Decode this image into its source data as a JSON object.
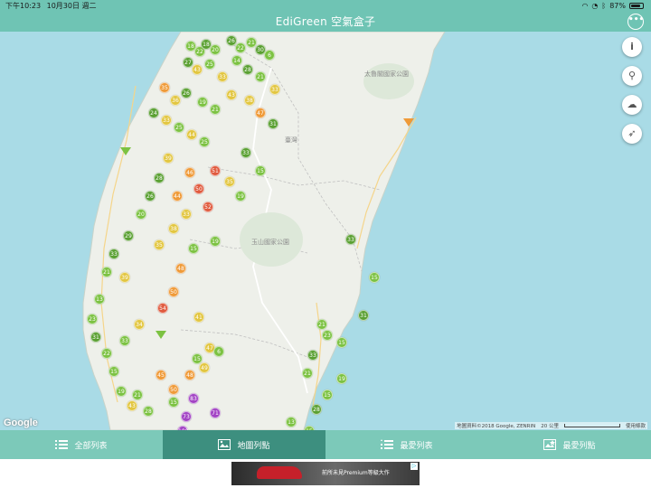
{
  "status_bar": {
    "time": "下午10:23",
    "date": "10月30日 週二",
    "battery": "87%",
    "battery_level": 0.87
  },
  "title_bar": {
    "title": "EdiGreen 空氣盒子",
    "more_icon": "ellipsis-icon"
  },
  "map": {
    "provider_logo": "Google",
    "attribution": "地圖資料©2018 Google, ZENRIN",
    "scale_label": "20 公里",
    "terms_label": "使用條款",
    "place_labels": [
      "太魯閣國家公園",
      "臺灣",
      "玉山國家公園"
    ],
    "controls": [
      {
        "name": "info-icon",
        "label": "i"
      },
      {
        "name": "location-pin-icon",
        "label": "⚲"
      },
      {
        "name": "cloud-icon",
        "label": "☁"
      },
      {
        "name": "navigate-icon",
        "label": "➶"
      }
    ],
    "markers": [
      {
        "v": "18",
        "c": "green"
      },
      {
        "v": "22",
        "c": "green"
      },
      {
        "v": "18",
        "c": "dgreen"
      },
      {
        "v": "20",
        "c": "green"
      },
      {
        "v": "26",
        "c": "dgreen"
      },
      {
        "v": "22",
        "c": "green"
      },
      {
        "v": "21",
        "c": "green"
      },
      {
        "v": "30",
        "c": "dgreen"
      },
      {
        "v": "6",
        "c": "green"
      },
      {
        "v": "27",
        "c": "dgreen"
      },
      {
        "v": "43",
        "c": "yellow"
      },
      {
        "v": "25",
        "c": "green"
      },
      {
        "v": "33",
        "c": "yellow"
      },
      {
        "v": "14",
        "c": "green"
      },
      {
        "v": "28",
        "c": "dgreen"
      },
      {
        "v": "21",
        "c": "green"
      },
      {
        "v": "33",
        "c": "yellow"
      },
      {
        "v": "35",
        "c": "orange"
      },
      {
        "v": "36",
        "c": "yellow"
      },
      {
        "v": "26",
        "c": "dgreen"
      },
      {
        "v": "19",
        "c": "green"
      },
      {
        "v": "21",
        "c": "green"
      },
      {
        "v": "43",
        "c": "yellow"
      },
      {
        "v": "38",
        "c": "yellow"
      },
      {
        "v": "47",
        "c": "orange"
      },
      {
        "v": "24",
        "c": "dgreen"
      },
      {
        "v": "33",
        "c": "yellow"
      },
      {
        "v": "25",
        "c": "green"
      },
      {
        "v": "44",
        "c": "yellow"
      },
      {
        "v": "25",
        "c": "green"
      },
      {
        "v": "39",
        "c": "yellow"
      },
      {
        "v": "28",
        "c": "dgreen"
      },
      {
        "v": "26",
        "c": "dgreen"
      },
      {
        "v": "20",
        "c": "green"
      },
      {
        "v": "29",
        "c": "dgreen"
      },
      {
        "v": "46",
        "c": "orange"
      },
      {
        "v": "51",
        "c": "red"
      },
      {
        "v": "35",
        "c": "yellow"
      },
      {
        "v": "19",
        "c": "green"
      },
      {
        "v": "44",
        "c": "orange"
      },
      {
        "v": "50",
        "c": "red"
      },
      {
        "v": "52",
        "c": "red"
      },
      {
        "v": "33",
        "c": "yellow"
      },
      {
        "v": "38",
        "c": "yellow"
      },
      {
        "v": "35",
        "c": "yellow"
      },
      {
        "v": "19",
        "c": "green"
      },
      {
        "v": "33",
        "c": "dgreen"
      },
      {
        "v": "15",
        "c": "green"
      },
      {
        "v": "31",
        "c": "dgreen"
      },
      {
        "v": "15",
        "c": "green"
      },
      {
        "v": "48",
        "c": "orange"
      },
      {
        "v": "50",
        "c": "orange"
      },
      {
        "v": "54",
        "c": "red"
      },
      {
        "v": "34",
        "c": "yellow"
      },
      {
        "v": "33",
        "c": "green"
      },
      {
        "v": "41",
        "c": "yellow"
      },
      {
        "v": "47",
        "c": "yellow"
      },
      {
        "v": "6",
        "c": "green"
      },
      {
        "v": "49",
        "c": "yellow"
      },
      {
        "v": "48",
        "c": "orange"
      },
      {
        "v": "50",
        "c": "orange"
      },
      {
        "v": "21",
        "c": "green"
      },
      {
        "v": "28",
        "c": "green"
      },
      {
        "v": "15",
        "c": "green"
      },
      {
        "v": "73",
        "c": "purple"
      },
      {
        "v": "83",
        "c": "purple"
      },
      {
        "v": "100",
        "c": "purple"
      },
      {
        "v": "71",
        "c": "purple"
      },
      {
        "v": "15",
        "c": "green"
      },
      {
        "v": "45",
        "c": "orange"
      },
      {
        "v": "39",
        "c": "yellow"
      },
      {
        "v": "33",
        "c": "dgreen"
      },
      {
        "v": "21",
        "c": "green"
      },
      {
        "v": "13",
        "c": "green"
      },
      {
        "v": "23",
        "c": "green"
      },
      {
        "v": "31",
        "c": "dgreen"
      },
      {
        "v": "22",
        "c": "green"
      },
      {
        "v": "15",
        "c": "green"
      },
      {
        "v": "19",
        "c": "green"
      },
      {
        "v": "43",
        "c": "yellow"
      }
    ]
  },
  "bottom_nav": {
    "tabs": [
      {
        "label": "全部列表",
        "icon": "list-icon"
      },
      {
        "label": "地圖列點",
        "icon": "map-icon",
        "active": true
      },
      {
        "label": "最愛列表",
        "icon": "favorites-list-icon"
      },
      {
        "label": "最愛列點",
        "icon": "favorites-map-icon"
      }
    ]
  },
  "ad": {
    "text": "前所未見Premium等級大作"
  },
  "colors": {
    "header": "#6fc4b4",
    "nav": "#7cc9b9",
    "nav_active": "#3d8f7f",
    "sea": "#a9dbe6",
    "land": "#eef0ea"
  }
}
